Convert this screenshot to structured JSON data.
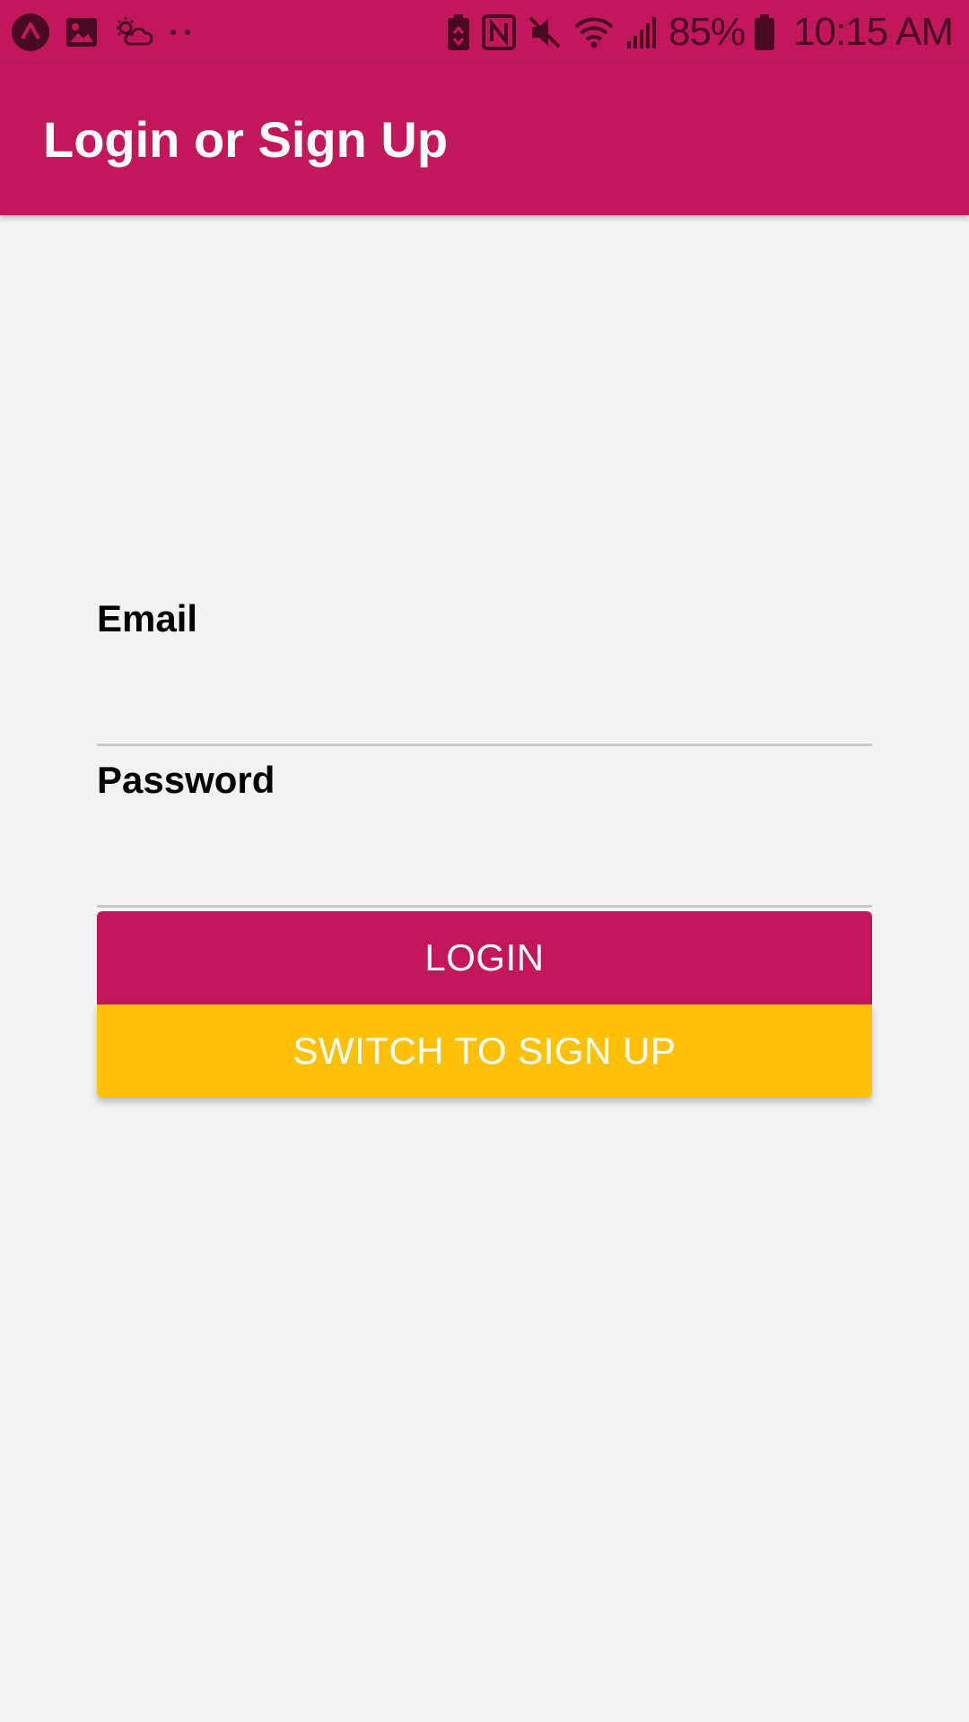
{
  "status_bar": {
    "left_icons": [
      "app-icon",
      "image-icon",
      "weather-icon",
      "more-dots-icon"
    ],
    "right_icons": [
      "battery-saver-icon",
      "nfc-icon",
      "mute-icon",
      "wifi-icon",
      "signal-icon"
    ],
    "battery_percent": "85%",
    "time": "10:15 AM"
  },
  "app_bar": {
    "title": "Login or Sign Up"
  },
  "form": {
    "email_label": "Email",
    "email_value": "",
    "password_label": "Password",
    "password_value": "",
    "login_button": "LOGIN",
    "switch_button": "SWITCH TO SIGN UP"
  },
  "colors": {
    "primary": "#c2185b",
    "accent": "#ffc107",
    "background": "#f2f2f2"
  }
}
